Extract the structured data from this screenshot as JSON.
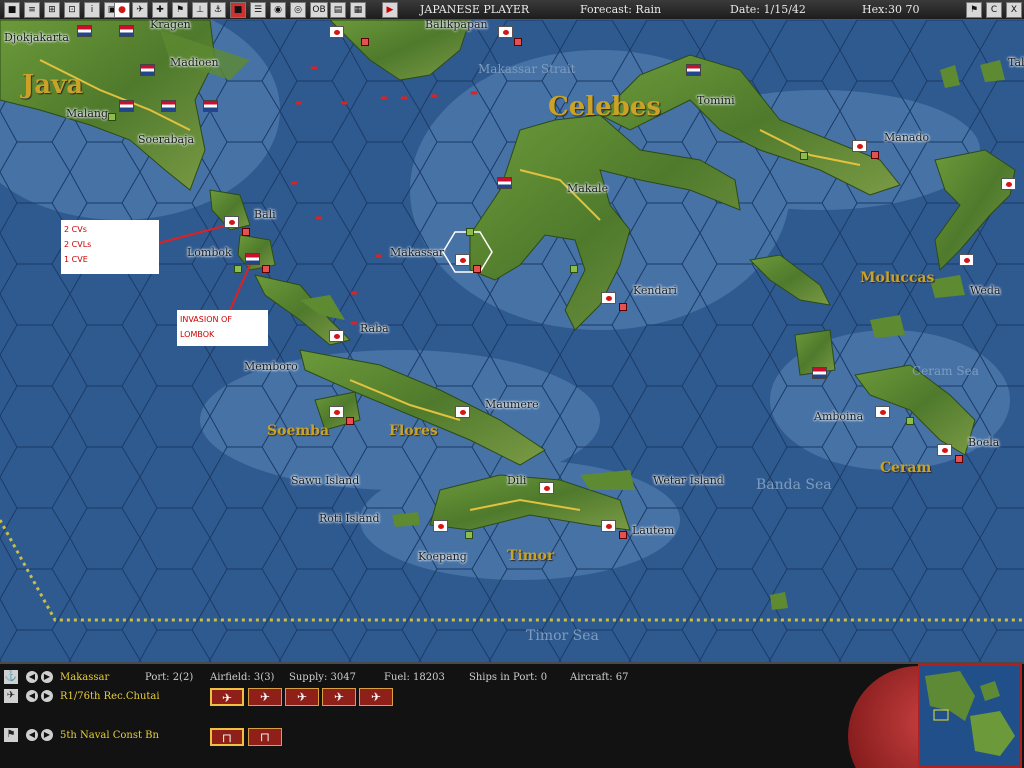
{
  "toolbar": {
    "player": "JAPANESE PLAYER",
    "forecast": "Forecast: Rain",
    "date": "Date: 1/15/42",
    "hex": "Hex:30 70",
    "buttons": [
      "save-icon",
      "report-icon",
      "ships-icon",
      "planes-icon",
      "info-icon",
      "flag-icon",
      "japan-flag-icon",
      "plane-icon",
      "fleet-icon",
      "base-icon",
      "air-icon",
      "land-icon",
      "ops-icon",
      "globe-icon",
      "OB",
      "list-icon",
      "disk-icon",
      "end-turn-icon"
    ],
    "right_buttons": [
      "flag-icon",
      "C",
      "X"
    ]
  },
  "map": {
    "big_labels": [
      "Java",
      "Celebes"
    ],
    "regions": [
      "Soemba",
      "Flores",
      "Timor",
      "Moluccas",
      "Ceram"
    ],
    "seas": [
      "Makassar Strait",
      "Banda Sea",
      "Timor Sea",
      "Ceram Sea"
    ],
    "towns": [
      "Djokjakarta",
      "Kragen",
      "Balikpapan",
      "Madioen",
      "Malang",
      "Soerabaja",
      "Tomini",
      "Manado",
      "Makale",
      "Bali",
      "Lombok",
      "Makassar",
      "Kendari",
      "Raba",
      "Memboro",
      "Maumere",
      "Weda",
      "Amboina",
      "Boela",
      "Sawu Island",
      "Roti Island",
      "Dili",
      "Wetar Island",
      "Koepang",
      "Lautem",
      "Tal"
    ],
    "note1": [
      "2 CVs",
      "2 CVLs",
      "1 CVE"
    ],
    "note2": "INVASION OF LOMBOK"
  },
  "panel": {
    "base_name": "Makassar",
    "port": "Port: 2(2)",
    "airfield": "Airfield: 3(3)",
    "supply": "Supply: 3047",
    "fuel": "Fuel: 18203",
    "ships": "Ships in Port: 0",
    "aircraft": "Aircraft: 67",
    "air_unit": "R1/76th Rec.Chutai",
    "land_unit": "5th Naval Const Bn"
  },
  "colors": {
    "sea": "#2f5a90",
    "land": "#5f8a35",
    "japan_red": "#d21717",
    "label_gold": "#c9a227"
  }
}
